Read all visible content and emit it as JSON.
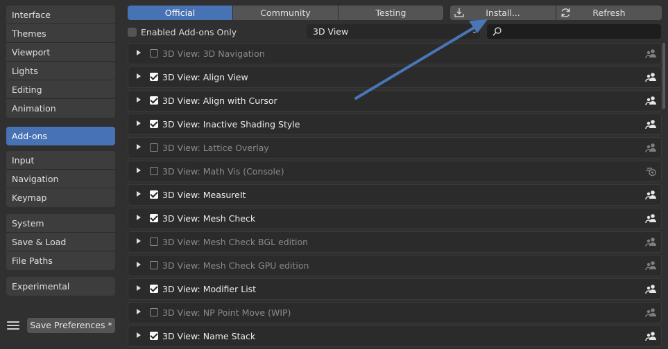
{
  "sidebar": {
    "group1": [
      "Interface",
      "Themes",
      "Viewport",
      "Lights",
      "Editing",
      "Animation"
    ],
    "group2": [
      "Add-ons"
    ],
    "group3": [
      "Input",
      "Navigation",
      "Keymap"
    ],
    "group4": [
      "System",
      "Save & Load",
      "File Paths"
    ],
    "group5": [
      "Experimental"
    ],
    "active": "Add-ons",
    "save_label": "Save Preferences *"
  },
  "tabs": [
    "Official",
    "Community",
    "Testing"
  ],
  "active_tab": "Official",
  "actions": {
    "install": "Install...",
    "refresh": "Refresh"
  },
  "filter": {
    "enabled_only_label": "Enabled Add-ons Only",
    "enabled_only_checked": false
  },
  "category": {
    "value": "3D View"
  },
  "search": {
    "placeholder": ""
  },
  "addons": [
    {
      "name": "3D View: 3D Navigation",
      "enabled": false,
      "icon": "community-icon"
    },
    {
      "name": "3D View: Align View",
      "enabled": true,
      "icon": "community-icon"
    },
    {
      "name": "3D View: Align with Cursor",
      "enabled": true,
      "icon": "community-icon"
    },
    {
      "name": "3D View: Inactive Shading Style",
      "enabled": true,
      "icon": "community-icon"
    },
    {
      "name": "3D View: Lattice Overlay",
      "enabled": false,
      "icon": "community-icon"
    },
    {
      "name": "3D View: Math Vis (Console)",
      "enabled": false,
      "icon": "blender-icon"
    },
    {
      "name": "3D View: MeasureIt",
      "enabled": true,
      "icon": "community-icon"
    },
    {
      "name": "3D View: Mesh Check",
      "enabled": true,
      "icon": "community-icon"
    },
    {
      "name": "3D View: Mesh Check BGL edition",
      "enabled": false,
      "icon": "community-icon"
    },
    {
      "name": "3D View: Mesh Check GPU edition",
      "enabled": false,
      "icon": "community-icon"
    },
    {
      "name": "3D View: Modifier List",
      "enabled": true,
      "icon": "community-icon"
    },
    {
      "name": "3D View: NP Point Move (WIP)",
      "enabled": false,
      "icon": "community-icon"
    },
    {
      "name": "3D View: Name Stack",
      "enabled": true,
      "icon": "community-icon"
    }
  ],
  "colors": {
    "accent": "#4772b3",
    "annotation_arrow": "#4a76b8"
  }
}
